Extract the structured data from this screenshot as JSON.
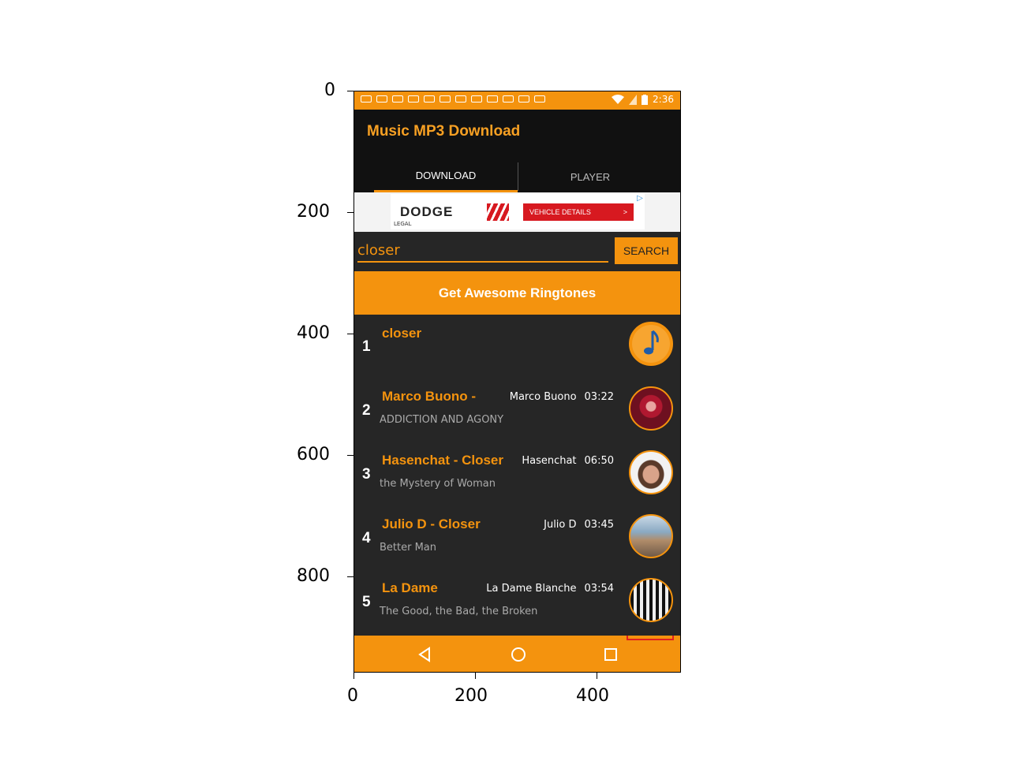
{
  "axes": {
    "y_ticks": [
      "0",
      "200",
      "400",
      "600",
      "800"
    ],
    "x_ticks": [
      "0",
      "200",
      "400"
    ]
  },
  "status_bar": {
    "time": "2:36",
    "icons": [
      "notification-icons",
      "wifi-icon",
      "signal-icon",
      "battery-icon"
    ]
  },
  "app": {
    "title": "Music MP3 Download",
    "tabs": [
      {
        "label": "DOWNLOAD",
        "active": true
      },
      {
        "label": "PLAYER",
        "active": false
      }
    ]
  },
  "ad": {
    "brand": "DODGE",
    "legal": "LEGAL",
    "button_label": "VEHICLE DETAILS",
    "button_arrow": ">"
  },
  "search": {
    "value": "closer",
    "button_label": "SEARCH"
  },
  "ringtones_button": "Get Awesome Ringtones",
  "results": [
    {
      "num": "1",
      "title": "closer",
      "artist": "",
      "duration": "",
      "album": ""
    },
    {
      "num": "2",
      "title": "Marco Buono -",
      "artist": "Marco Buono",
      "duration": "03:22",
      "album": "ADDICTION AND AGONY"
    },
    {
      "num": "3",
      "title": "Hasenchat - Closer",
      "artist": "Hasenchat",
      "duration": "06:50",
      "album": "the Mystery of Woman"
    },
    {
      "num": "4",
      "title": "Julio D - Closer",
      "artist": "Julio D",
      "duration": "03:45",
      "album": "Better Man"
    },
    {
      "num": "5",
      "title": "La Dame",
      "artist": "La Dame Blanche",
      "duration": "03:54",
      "album": "The Good, the Bad, the Broken"
    }
  ],
  "colors": {
    "accent": "#f4930e",
    "appbar": "#111111",
    "list_bg": "#262626"
  }
}
